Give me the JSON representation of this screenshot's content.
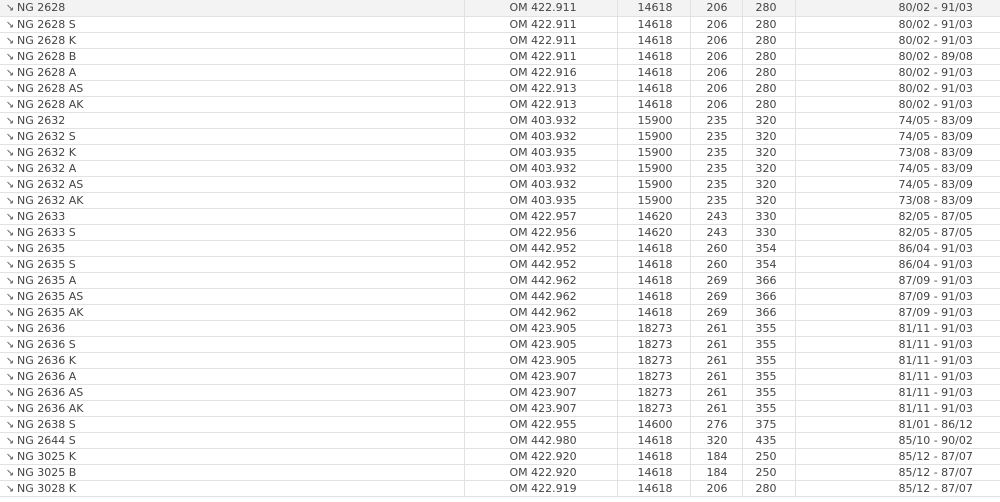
{
  "rows": [
    {
      "model": "NG 2628",
      "engine": "OM 422.911",
      "code": "14618",
      "kw": "206",
      "hp": "280",
      "years": "80/02 - 91/03"
    },
    {
      "model": "NG 2628 S",
      "engine": "OM 422.911",
      "code": "14618",
      "kw": "206",
      "hp": "280",
      "years": "80/02 - 91/03"
    },
    {
      "model": "NG 2628 K",
      "engine": "OM 422.911",
      "code": "14618",
      "kw": "206",
      "hp": "280",
      "years": "80/02 - 91/03"
    },
    {
      "model": "NG 2628 B",
      "engine": "OM 422.911",
      "code": "14618",
      "kw": "206",
      "hp": "280",
      "years": "80/02 - 89/08"
    },
    {
      "model": "NG 2628 A",
      "engine": "OM 422.916",
      "code": "14618",
      "kw": "206",
      "hp": "280",
      "years": "80/02 - 91/03"
    },
    {
      "model": "NG 2628 AS",
      "engine": "OM 422.913",
      "code": "14618",
      "kw": "206",
      "hp": "280",
      "years": "80/02 - 91/03"
    },
    {
      "model": "NG 2628 AK",
      "engine": "OM 422.913",
      "code": "14618",
      "kw": "206",
      "hp": "280",
      "years": "80/02 - 91/03"
    },
    {
      "model": "NG 2632",
      "engine": "OM 403.932",
      "code": "15900",
      "kw": "235",
      "hp": "320",
      "years": "74/05 - 83/09"
    },
    {
      "model": "NG 2632 S",
      "engine": "OM 403.932",
      "code": "15900",
      "kw": "235",
      "hp": "320",
      "years": "74/05 - 83/09"
    },
    {
      "model": "NG 2632 K",
      "engine": "OM 403.935",
      "code": "15900",
      "kw": "235",
      "hp": "320",
      "years": "73/08 - 83/09"
    },
    {
      "model": "NG 2632 A",
      "engine": "OM 403.932",
      "code": "15900",
      "kw": "235",
      "hp": "320",
      "years": "74/05 - 83/09"
    },
    {
      "model": "NG 2632 AS",
      "engine": "OM 403.932",
      "code": "15900",
      "kw": "235",
      "hp": "320",
      "years": "74/05 - 83/09"
    },
    {
      "model": "NG 2632 AK",
      "engine": "OM 403.935",
      "code": "15900",
      "kw": "235",
      "hp": "320",
      "years": "73/08 - 83/09"
    },
    {
      "model": "NG 2633",
      "engine": "OM 422.957",
      "code": "14620",
      "kw": "243",
      "hp": "330",
      "years": "82/05 - 87/05"
    },
    {
      "model": "NG 2633 S",
      "engine": "OM 422.956",
      "code": "14620",
      "kw": "243",
      "hp": "330",
      "years": "82/05 - 87/05"
    },
    {
      "model": "NG 2635",
      "engine": "OM 442.952",
      "code": "14618",
      "kw": "260",
      "hp": "354",
      "years": "86/04 - 91/03"
    },
    {
      "model": "NG 2635 S",
      "engine": "OM 442.952",
      "code": "14618",
      "kw": "260",
      "hp": "354",
      "years": "86/04 - 91/03"
    },
    {
      "model": "NG 2635 A",
      "engine": "OM 442.962",
      "code": "14618",
      "kw": "269",
      "hp": "366",
      "years": "87/09 - 91/03"
    },
    {
      "model": "NG 2635 AS",
      "engine": "OM 442.962",
      "code": "14618",
      "kw": "269",
      "hp": "366",
      "years": "87/09 - 91/03"
    },
    {
      "model": "NG 2635 AK",
      "engine": "OM 442.962",
      "code": "14618",
      "kw": "269",
      "hp": "366",
      "years": "87/09 - 91/03"
    },
    {
      "model": "NG 2636",
      "engine": "OM 423.905",
      "code": "18273",
      "kw": "261",
      "hp": "355",
      "years": "81/11 - 91/03"
    },
    {
      "model": "NG 2636 S",
      "engine": "OM 423.905",
      "code": "18273",
      "kw": "261",
      "hp": "355",
      "years": "81/11 - 91/03"
    },
    {
      "model": "NG 2636 K",
      "engine": "OM 423.905",
      "code": "18273",
      "kw": "261",
      "hp": "355",
      "years": "81/11 - 91/03"
    },
    {
      "model": "NG 2636 A",
      "engine": "OM 423.907",
      "code": "18273",
      "kw": "261",
      "hp": "355",
      "years": "81/11 - 91/03"
    },
    {
      "model": "NG 2636 AS",
      "engine": "OM 423.907",
      "code": "18273",
      "kw": "261",
      "hp": "355",
      "years": "81/11 - 91/03"
    },
    {
      "model": "NG 2636 AK",
      "engine": "OM 423.907",
      "code": "18273",
      "kw": "261",
      "hp": "355",
      "years": "81/11 - 91/03"
    },
    {
      "model": "NG 2638 S",
      "engine": "OM 422.955",
      "code": "14600",
      "kw": "276",
      "hp": "375",
      "years": "81/01 - 86/12"
    },
    {
      "model": "NG 2644 S",
      "engine": "OM 442.980",
      "code": "14618",
      "kw": "320",
      "hp": "435",
      "years": "85/10 - 90/02"
    },
    {
      "model": "NG 3025 K",
      "engine": "OM 422.920",
      "code": "14618",
      "kw": "184",
      "hp": "250",
      "years": "85/12 - 87/07"
    },
    {
      "model": "NG 3025 B",
      "engine": "OM 422.920",
      "code": "14618",
      "kw": "184",
      "hp": "250",
      "years": "85/12 - 87/07"
    },
    {
      "model": "NG 3028 K",
      "engine": "OM 422.919",
      "code": "14618",
      "kw": "206",
      "hp": "280",
      "years": "85/12 - 87/07"
    }
  ]
}
